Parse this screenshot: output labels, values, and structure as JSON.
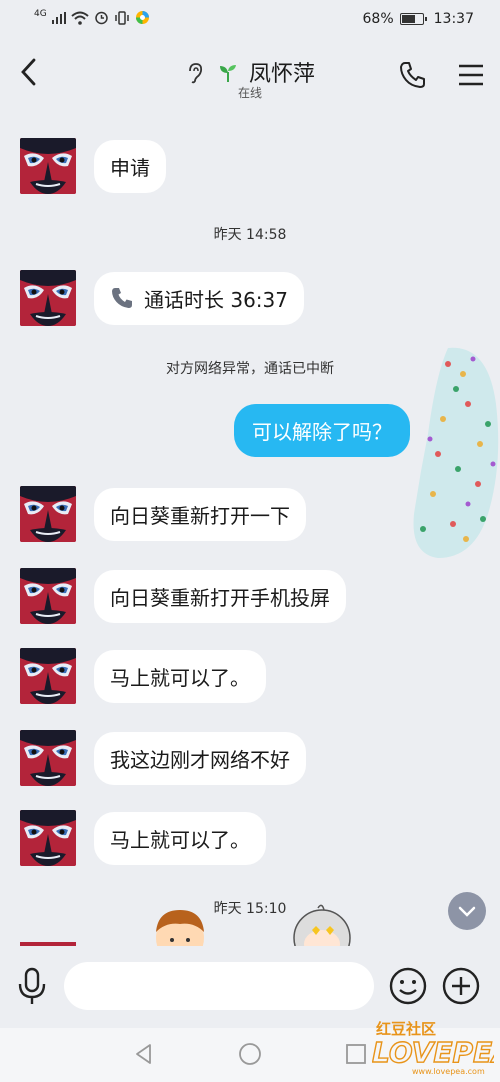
{
  "status": {
    "signal_label": "4G",
    "battery_percent": "68%",
    "battery_level": 0.68,
    "time": "13:37"
  },
  "header": {
    "contact_name": "凤怀萍",
    "presence": "在线"
  },
  "messages": [
    {
      "text": "申请"
    },
    {
      "text": "通话时长 36:37"
    },
    {
      "text": "可以解除了吗？"
    },
    {
      "text": "向日葵重新打开一下"
    },
    {
      "text": "向日葵重新打开手机投屏"
    },
    {
      "text": "马上就可以了。"
    },
    {
      "text": "我这边刚才网络不好"
    },
    {
      "text": "马上就可以了。"
    }
  ],
  "timestamps": [
    "昨天 14:58",
    "昨天 15:10"
  ],
  "system_notice": "对方网络异常，通话已中断",
  "input": {
    "placeholder": ""
  },
  "watermark": {
    "top": "红豆社区",
    "brand": "LOVEPEA",
    "url": "www.lovepea.com"
  },
  "colors": {
    "sent_bubble": "#27b8f2",
    "avatar_red": "#b3243a",
    "background": "#eceef2"
  }
}
